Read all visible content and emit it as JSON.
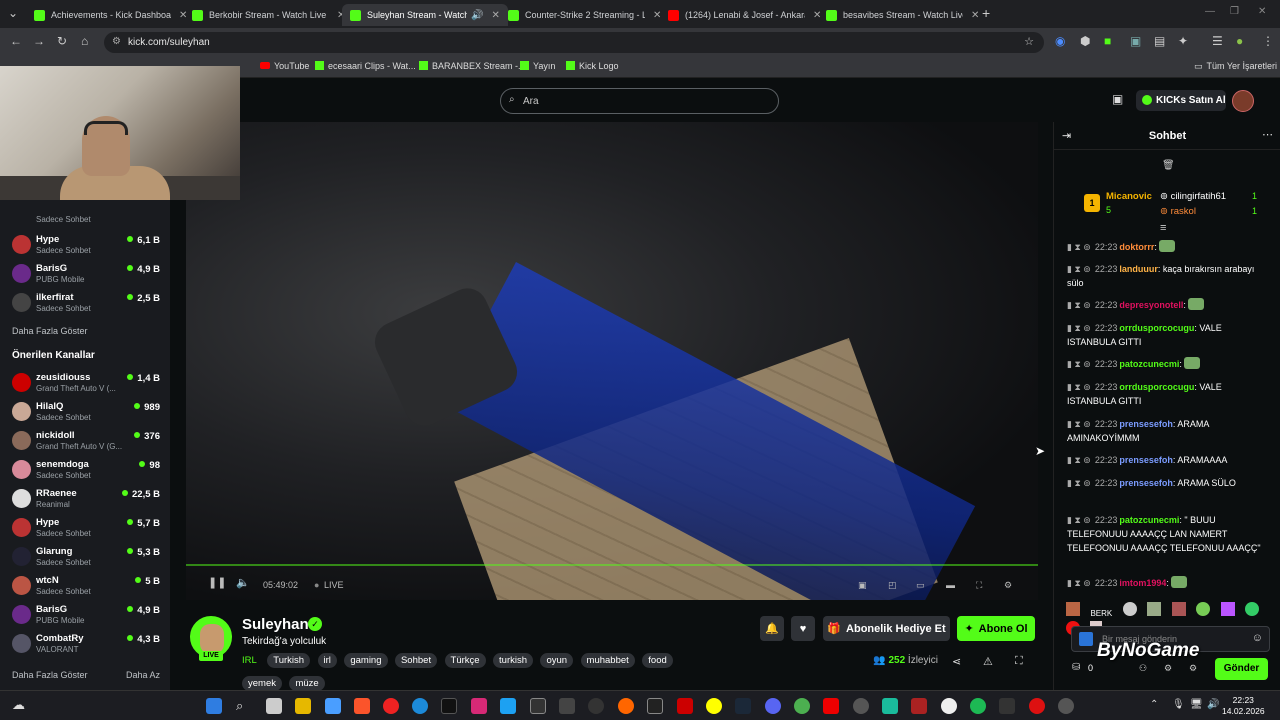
{
  "browser": {
    "tabs": [
      {
        "title": "Achievements - Kick Dashboard",
        "icon": "kick"
      },
      {
        "title": "Berkobir Stream - Watch Live o",
        "icon": "kick"
      },
      {
        "title": "Suleyhan Stream - Watch Li",
        "icon": "kick"
      },
      {
        "title": "Counter-Strike 2 Streaming - L",
        "icon": "kick"
      },
      {
        "title": "(1264) Lenabi & Josef - Ankara",
        "icon": "youtube"
      },
      {
        "title": "besavibes Stream - Watch Live",
        "icon": "kick"
      }
    ],
    "url": "kick.com/suleyhan",
    "bookmarks": [
      "YouTube",
      "ecesaari Clips - Wat...",
      "BARANBEX Stream -...",
      "Yayın",
      "Kick Logo"
    ],
    "other_bookmarks": "Tüm Yer İşaretleri"
  },
  "kick": {
    "search_placeholder": "Ara",
    "buy_kicks": "KICKs Satın Al"
  },
  "sidebar": {
    "top_channels": [
      {
        "name": "Hype",
        "game": "Sadece Sohbet",
        "viewers": "6,1 B"
      },
      {
        "name": "BarisG",
        "game": "PUBG Mobile",
        "viewers": "4,9 B"
      },
      {
        "name": "ilkerfirat",
        "game": "Sadece Sohbet",
        "viewers": "2,5 B"
      }
    ],
    "top_partial_game": "Sadece Sohbet",
    "show_more": "Daha Fazla Göster",
    "recommended_heading": "Önerilen Kanallar",
    "recommended": [
      {
        "name": "zeusidiouss",
        "game": "Grand Theft Auto V (...",
        "viewers": "1,4 B"
      },
      {
        "name": "HilalQ",
        "game": "Sadece Sohbet",
        "viewers": "989"
      },
      {
        "name": "nickidoll",
        "game": "Grand Theft Auto V (G...",
        "viewers": "376"
      },
      {
        "name": "senemdoga",
        "game": "Sadece Sohbet",
        "viewers": "98"
      },
      {
        "name": "RRaenee",
        "game": "Reanimal",
        "viewers": "22,5 B"
      },
      {
        "name": "Hype",
        "game": "Sadece Sohbet",
        "viewers": "5,7 B"
      },
      {
        "name": "Glarung",
        "game": "Sadece Sohbet",
        "viewers": "5,3 B"
      },
      {
        "name": "wtcN",
        "game": "Sadece Sohbet",
        "viewers": "5 B"
      },
      {
        "name": "BarisG",
        "game": "PUBG Mobile",
        "viewers": "4,9 B"
      },
      {
        "name": "CombatRy",
        "game": "VALORANT",
        "viewers": "4,3 B"
      }
    ],
    "show_more_2": "Daha Fazla Göster",
    "show_less": "Daha Az"
  },
  "player": {
    "time": "05:49:02",
    "live": "LIVE"
  },
  "stream": {
    "streamer": "Suleyhan",
    "live_badge": "LIVE",
    "title": "Tekirdağ'a yolculuk",
    "category": "IRL",
    "tags": [
      "Turkish",
      "irl",
      "gaming",
      "Sohbet",
      "Türkçe",
      "turkish",
      "oyun",
      "muhabbet",
      "food",
      "yemek",
      "müze"
    ],
    "gift_sub": "Abonelik Hediye Et",
    "subscribe": "Abone Ol",
    "viewer_count": "252",
    "viewer_label": "İzleyici"
  },
  "chat": {
    "title": "Sohbet",
    "pinned": {
      "left_rank": "1",
      "left_user": "Micanovic",
      "left_count": "5",
      "right_users": [
        {
          "name": "cilingirfatih61",
          "count": "1"
        },
        {
          "name": "raskol",
          "count": "1"
        }
      ]
    },
    "messages": [
      {
        "time": "22:23",
        "user": "doktorrr",
        "color": "#ff8c3a",
        "text": ""
      },
      {
        "time": "22:23",
        "user": "landuuur",
        "color": "#ffb347",
        "text": "kaça bırakırsın arabayı sülo"
      },
      {
        "time": "22:23",
        "user": "depresyonotell",
        "color": "#e0115f",
        "text": ""
      },
      {
        "time": "22:23",
        "user": "orrdusporcocugu",
        "color": "#53fc18",
        "text": "VALE ISTANBULA GITTI"
      },
      {
        "time": "22:23",
        "user": "patozcunecmi",
        "color": "#53fc18",
        "text": ""
      },
      {
        "time": "22:23",
        "user": "orrdusporcocugu",
        "color": "#53fc18",
        "text": "VALE ISTANBULA GITTI"
      },
      {
        "time": "22:23",
        "user": "prensesefoh",
        "color": "#7b9cff",
        "text": "ARAMA AMINAKOYİMMM"
      },
      {
        "time": "22:23",
        "user": "prensesefoh",
        "color": "#7b9cff",
        "text": "ARAMAAAA"
      },
      {
        "time": "22:23",
        "user": "prensesefoh",
        "color": "#7b9cff",
        "text": "ARAMA SÜLO"
      },
      {
        "time": "22:23",
        "user": "patozcunecmi",
        "color": "#53fc18",
        "text": "\" BUUU TELEFONUUU AAAAÇÇ LAN NAMERT TELEFOONUU AAAAÇÇ TELEFONUU AAAÇÇ\""
      },
      {
        "time": "22:23",
        "user": "imtom1994",
        "color": "#e0115f",
        "text": ""
      }
    ],
    "input_placeholder": "Bir mesaj gönderin",
    "send": "Gönder",
    "points": "0"
  },
  "watermark": "ByNoGame",
  "taskbar": {
    "time": "22:23",
    "date": "14.02.2026"
  }
}
